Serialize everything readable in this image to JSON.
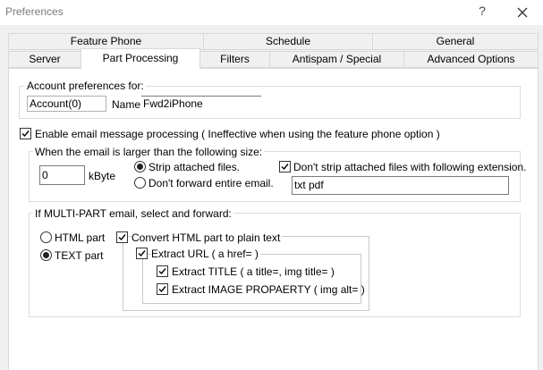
{
  "window": {
    "title": "Preferences",
    "help": "?"
  },
  "tabs_row1": [
    "Feature Phone",
    "Schedule",
    "General"
  ],
  "tabs_row2": [
    "Server",
    "Part Processing",
    "Filters",
    "Antispam / Special",
    "Advanced Options"
  ],
  "active_tab": "Part Processing",
  "account": {
    "group_label": "Account preferences for:",
    "account_value": "Account(0)",
    "name_label": "Name:",
    "name_value": "Fwd2iPhone"
  },
  "enable_processing": {
    "label": "Enable email message processing ( Ineffective when using the feature phone option )",
    "checked": true
  },
  "size_group": {
    "label": "When the email is larger than the following size:",
    "size_value": "0",
    "unit": "kByte",
    "strip_label": "Strip attached files.",
    "strip_selected": true,
    "dont_forward_label": "Don't forward entire email.",
    "dont_forward_selected": false,
    "dont_strip_ext_label": "Don't strip attached files with following extension.",
    "dont_strip_ext_checked": true,
    "extensions_value": "txt pdf"
  },
  "multipart_group": {
    "label": "If MULTI-PART email, select and forward:",
    "html_label": "HTML part",
    "html_selected": false,
    "text_label": "TEXT part",
    "text_selected": true,
    "convert_label": "Convert HTML part to plain text",
    "convert_checked": true,
    "extract_url_label": "Extract URL ( a href= )",
    "extract_url_checked": true,
    "extract_title_label": "Extract TITLE ( a title=, img title= )",
    "extract_title_checked": true,
    "extract_image_label": "Extract IMAGE PROPAERTY ( img alt= )",
    "extract_image_checked": true
  }
}
